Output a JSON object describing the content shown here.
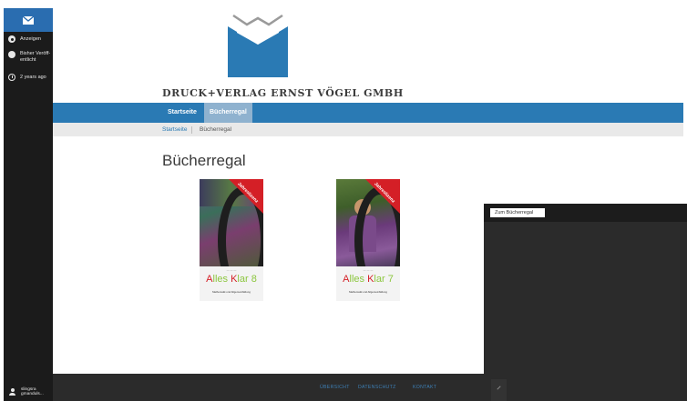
{
  "sidebar": {
    "items": [
      {
        "label": "Anzeigen",
        "icon": "eye-icon"
      },
      {
        "label": "Bisher Veröff-entlicht",
        "icon": "globe-icon"
      },
      {
        "label": "2 years ago",
        "icon": "clock-icon"
      }
    ],
    "user_label": "slingsra gmanduls..."
  },
  "brand": {
    "name": "DRUCK+VERLAG ERNST VÖGEL GMBH"
  },
  "nav": {
    "items": [
      {
        "label": "Startseite"
      },
      {
        "label": "Bücherregal"
      }
    ]
  },
  "breadcrumb": {
    "home": "Startseite",
    "current": "Bücherregal"
  },
  "page": {
    "title": "Bücherregal"
  },
  "books": [
    {
      "ribbon": "Jahreslizenz",
      "series_a": "A",
      "series_mid": "lles ",
      "series_k": "K",
      "series_end": "lar 8",
      "sub": "Mathematik und Allgemeinbildung"
    },
    {
      "ribbon": "Jahreslizenz",
      "series_a": "A",
      "series_mid": "lles ",
      "series_k": "K",
      "series_end": "lar 7",
      "sub": "Mathematik und Allgemeinbildung"
    }
  ],
  "footer": {
    "links": [
      "ÜBERSICHT",
      "DATENSCHUTZ",
      "KONTAKT"
    ]
  },
  "overlay": {
    "button_label": "Zum Bücherregal"
  },
  "colors": {
    "accent": "#2a7ab4",
    "nav_active": "#8fb2cf",
    "ribbon": "#d41f26",
    "series_green": "#8cc63f"
  }
}
